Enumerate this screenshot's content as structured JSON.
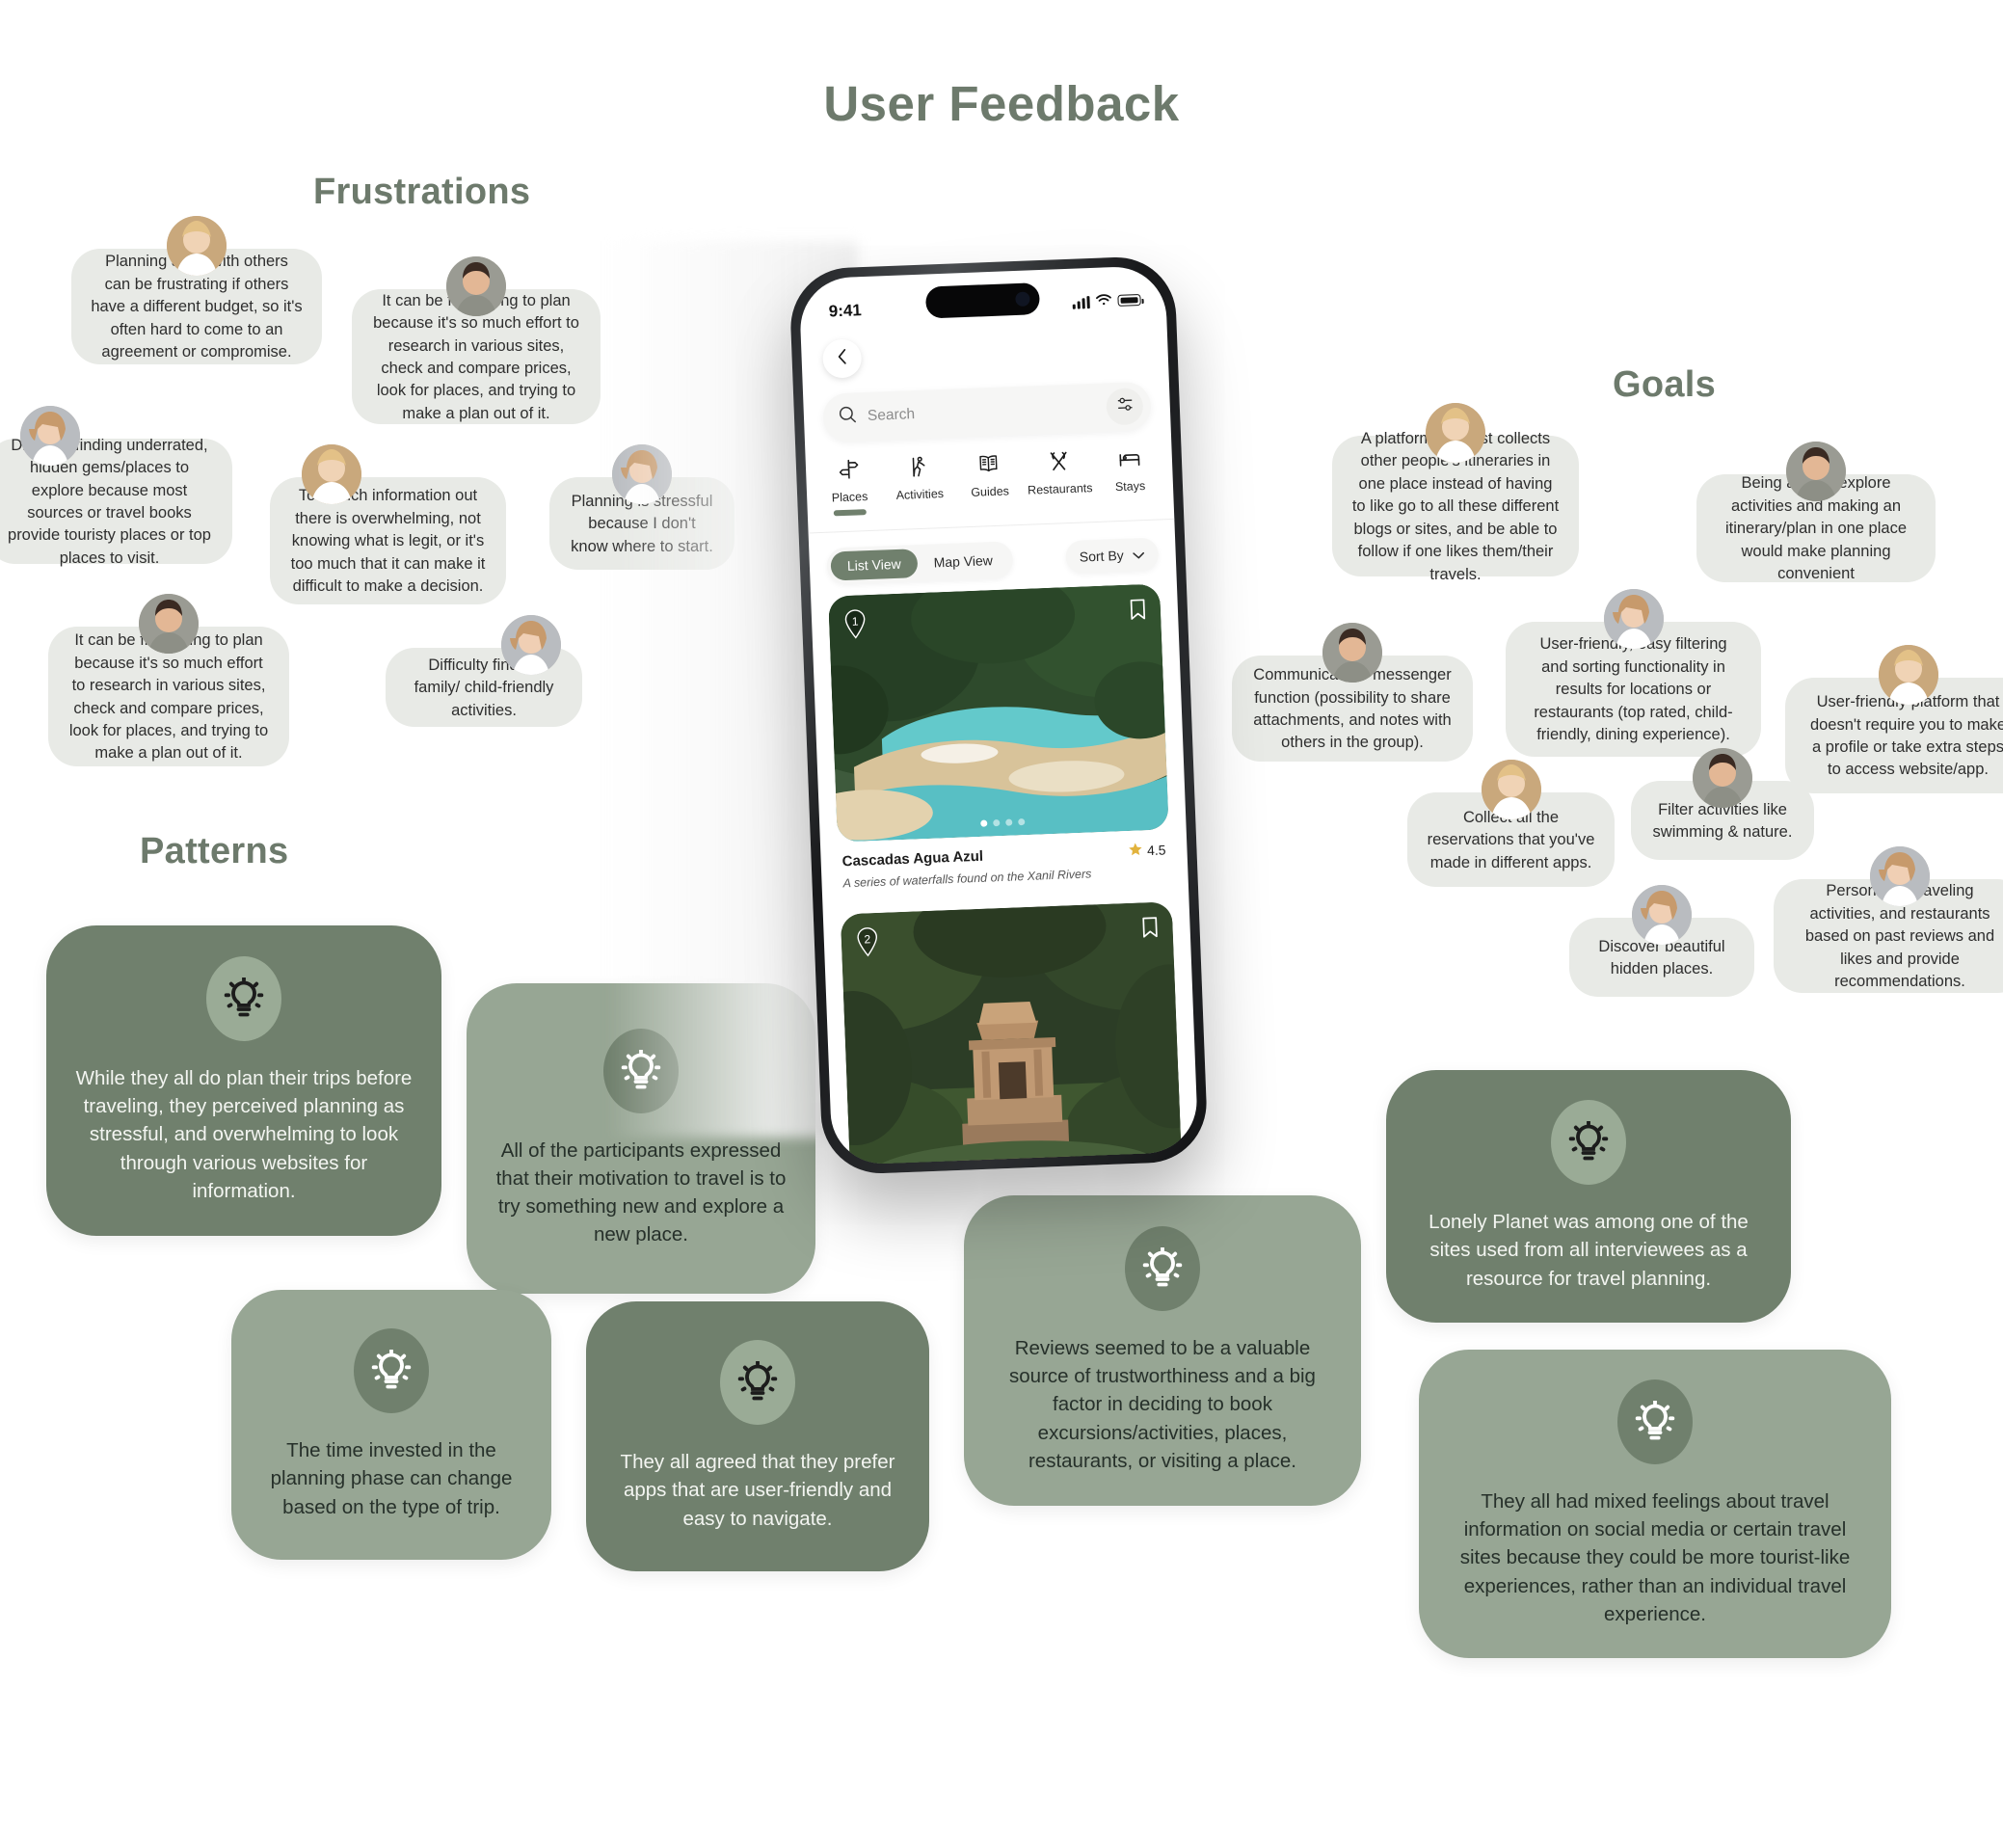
{
  "page": {
    "title": "User Feedback",
    "accent_color": "#6d7a6c",
    "bubble_bg": "#e8eae6",
    "card_dark": "#70806d",
    "card_light": "#97a694"
  },
  "sections": {
    "frustrations": {
      "title": "Frustrations"
    },
    "goals": {
      "title": "Goals"
    },
    "patterns": {
      "title": "Patterns"
    }
  },
  "frustrations": [
    {
      "text": "Planning a trip with others can be frustrating if others have a different budget, so it's often hard to come to an agreement or compromise.",
      "avatar": "avatar-woman-blonde"
    },
    {
      "text": "It can be frustrating to plan because it's so much effort to research in various sites, check and compare prices, look for places, and trying to make a plan out of it.",
      "avatar": "avatar-man-brown-hair"
    },
    {
      "text": "Difficulty finding underrated, hidden gems/places to explore because most sources or travel books provide touristy places or top places to visit.",
      "avatar": "avatar-woman-curly"
    },
    {
      "text": "Too much information out there is overwhelming, not knowing what is legit, or it's too much that it can make it difficult to make a decision.",
      "avatar": "avatar-woman-blonde"
    },
    {
      "text": "Planning is stressful because I don't know where to start.",
      "avatar": "avatar-woman-curly"
    },
    {
      "text": "It can be frustrating to plan because it's so much effort to research in various sites, check and compare prices, look for places, and trying to make a plan out of it.",
      "avatar": "avatar-man-brown-hair"
    },
    {
      "text": "Difficulty finding family/ child-friendly activities.",
      "avatar": "avatar-woman-curly"
    }
  ],
  "goals": [
    {
      "text": "A platform that just collects other people's itineraries in one place instead of having to like go to all these different blogs or sites, and be able to follow if one likes them/their travels.",
      "avatar": "avatar-woman-blonde"
    },
    {
      "text": "Being able to explore activities and making an itinerary/plan in one place would make planning convenient",
      "avatar": "avatar-man-brown-hair"
    },
    {
      "text": "Communication/ messenger function (possibility to share attachments, and notes with others in the group).",
      "avatar": "avatar-man-brown-hair"
    },
    {
      "text": "User-friendly, easy filtering and sorting functionality in results for locations or restaurants (top rated, child-friendly, dining experience).",
      "avatar": "avatar-woman-curly"
    },
    {
      "text": "User-friendly platform that doesn't require you to make a profile or take extra steps to access website/app.",
      "avatar": "avatar-woman-blonde"
    },
    {
      "text": "Collect all the reservations that you've made in different apps.",
      "avatar": "avatar-woman-blonde"
    },
    {
      "text": "Filter activities like swimming & nature.",
      "avatar": "avatar-man-brown-hair"
    },
    {
      "text": "Discover beautiful hidden places.",
      "avatar": "avatar-woman-curly"
    },
    {
      "text": "Personalize traveling activities, and restaurants based on past reviews and likes and provide recommendations.",
      "avatar": "avatar-woman-curly"
    }
  ],
  "patterns": [
    {
      "text": "While they all do plan their trips before traveling, they perceived planning as stressful, and overwhelming to look through various websites for information.",
      "tone": "dark",
      "icon": "lightbulb-icon"
    },
    {
      "text": "All of the participants expressed that their motivation to travel is to try something new and explore a new place.",
      "tone": "light",
      "icon": "lightbulb-icon"
    },
    {
      "text": "The time invested in the planning phase can change based on the type of trip.",
      "tone": "light",
      "icon": "lightbulb-icon"
    },
    {
      "text": "They all agreed that they prefer apps that are user-friendly and easy to navigate.",
      "tone": "dark",
      "icon": "lightbulb-icon"
    },
    {
      "text": "Reviews seemed to be a valuable source of trustworthiness and a big factor in deciding to book excursions/activities, places, restaurants, or visiting a place.",
      "tone": "light",
      "icon": "lightbulb-icon"
    },
    {
      "text": "Lonely Planet was among one of the sites used from all interviewees as a resource for travel planning.",
      "tone": "dark",
      "icon": "lightbulb-icon"
    },
    {
      "text": "They all had mixed feelings about travel information on social media or certain travel sites because they could be more tourist-like experiences, rather than an individual travel experience.",
      "tone": "light",
      "icon": "lightbulb-icon"
    }
  ],
  "phone": {
    "status": {
      "time": "9:41",
      "signal": "signal-bars-icon",
      "wifi": "wifi-icon",
      "battery": "battery-icon"
    },
    "back_label": "back-chevron-icon",
    "search": {
      "placeholder": "Search",
      "filter_icon": "sliders-icon"
    },
    "categories": [
      {
        "label": "Places",
        "icon": "signpost-icon",
        "active": true
      },
      {
        "label": "Activities",
        "icon": "hiker-icon",
        "active": false
      },
      {
        "label": "Guides",
        "icon": "open-book-icon",
        "active": false
      },
      {
        "label": "Restaurants",
        "icon": "fork-knife-icon",
        "active": false
      },
      {
        "label": "Stays",
        "icon": "bed-icon",
        "active": false
      }
    ],
    "view_toggle": {
      "list": "List View",
      "map": "Map View",
      "selected": "List View"
    },
    "sort": {
      "label": "Sort By",
      "icon": "chevron-down-icon"
    },
    "listing": {
      "index": "1",
      "title": "Cascadas Agua Azul",
      "subtitle": "A series of waterfalls found on the Xanil Rivers",
      "rating": "4.5",
      "star": "star-icon",
      "bookmark": "bookmark-icon",
      "dots": 4,
      "active_dot": 1
    },
    "listing2": {
      "index": "2",
      "bookmark": "bookmark-icon"
    }
  }
}
